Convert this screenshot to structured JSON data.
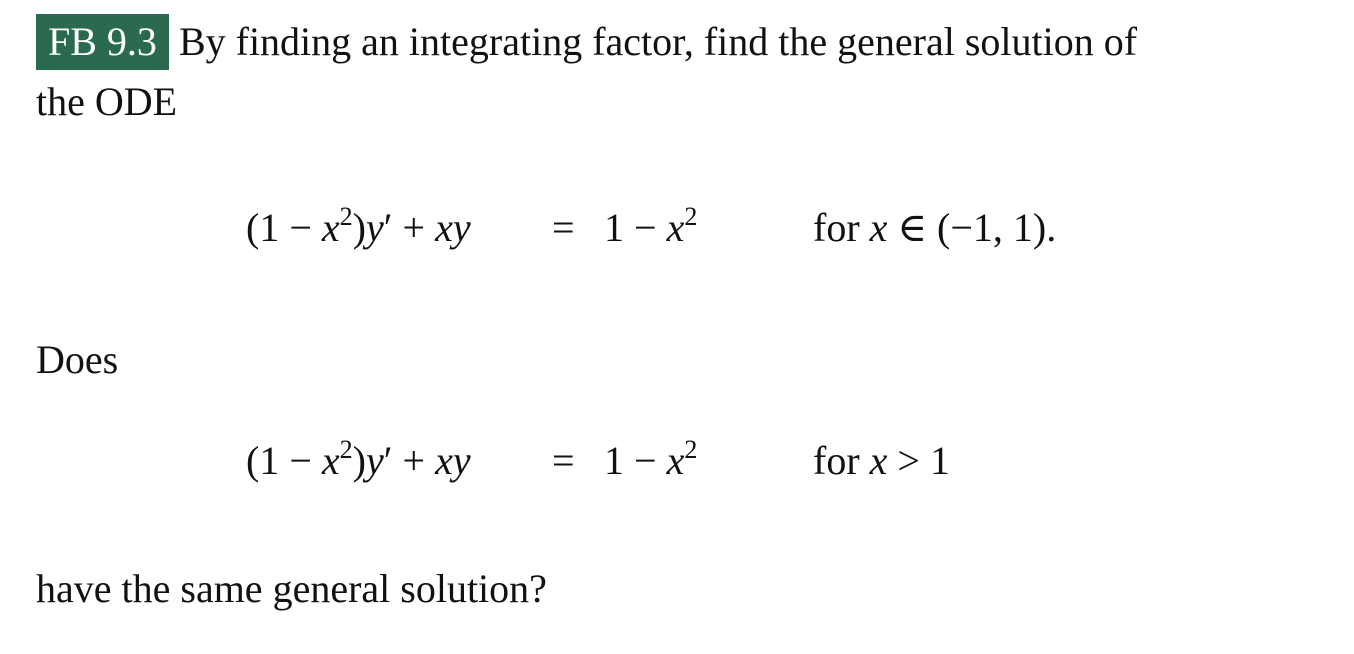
{
  "problem": {
    "badge": "FB 9.3",
    "intro_line1": "By finding an integrating factor, find the general solution of",
    "intro_line2": "the ODE",
    "equation1": {
      "lhs_parts": [
        "(1 − ",
        "x",
        "2",
        ")",
        "y",
        "′ + ",
        "x",
        "y"
      ],
      "relation": "=",
      "rhs_parts": [
        "1 − ",
        "x",
        "2"
      ],
      "condition_prefix": "for ",
      "condition_var": "x",
      "condition_rest": " ∈ (−1, 1)."
    },
    "middle_text": "Does",
    "equation2": {
      "lhs_parts": [
        "(1 − ",
        "x",
        "2",
        ")",
        "y",
        "′ + ",
        "x",
        "y"
      ],
      "relation": "=",
      "rhs_parts": [
        "1 − ",
        "x",
        "2"
      ],
      "condition_prefix": "for ",
      "condition_var": "x",
      "condition_rest": " > 1"
    },
    "closing_text": "have the same general solution?"
  }
}
